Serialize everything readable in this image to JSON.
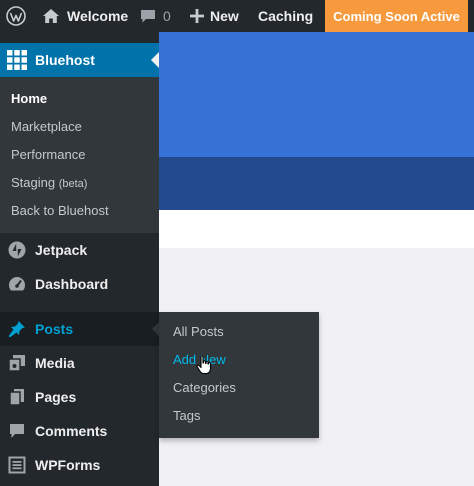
{
  "adminbar": {
    "site_name": "Welcome",
    "comments_count": "0",
    "new_label": "New",
    "caching_label": "Caching",
    "coming_soon_label": "Coming Soon Active",
    "coming_soon_color": "#f79a3e",
    "icons": [
      "wordpress-logo-icon",
      "home-icon",
      "comment-bubble-icon",
      "plus-icon"
    ]
  },
  "sidebar": {
    "bluehost": {
      "label": "Bluehost",
      "submenu": [
        {
          "label": "Home",
          "current": true
        },
        {
          "label": "Marketplace"
        },
        {
          "label": "Performance"
        },
        {
          "label": "Staging",
          "suffix": "(beta)"
        },
        {
          "label": "Back to Bluehost"
        }
      ]
    },
    "items": [
      {
        "label": "Jetpack",
        "icon": "jetpack-icon"
      },
      {
        "label": "Dashboard",
        "icon": "dashboard-gauge-icon"
      },
      {
        "label": "Posts",
        "icon": "pushpin-icon",
        "active": true
      },
      {
        "label": "Media",
        "icon": "media-icon"
      },
      {
        "label": "Pages",
        "icon": "pages-icon"
      },
      {
        "label": "Comments",
        "icon": "comment-icon"
      },
      {
        "label": "WPForms",
        "icon": "wpforms-icon"
      }
    ]
  },
  "posts_flyout": {
    "items": [
      {
        "label": "All Posts"
      },
      {
        "label": "Add New",
        "hovered": true
      },
      {
        "label": "Categories"
      },
      {
        "label": "Tags"
      }
    ]
  },
  "colors": {
    "sidebar_bg": "#23282d",
    "submenu_bg": "#32373c",
    "accent_blue": "#0073aa",
    "link_hover": "#00b9eb",
    "hero_blue": "#3773d6",
    "hero_dark_blue": "#234a8c"
  }
}
